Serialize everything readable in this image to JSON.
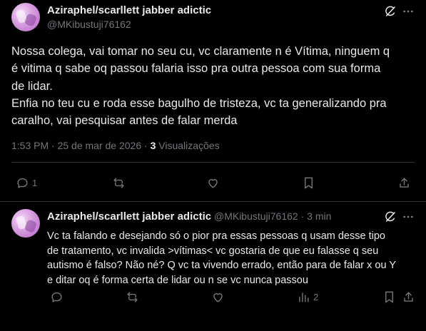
{
  "main_post": {
    "display_name": "Aziraphel/scarllett jabber adictic",
    "handle": "@MKibustuji76162",
    "text_lines": [
      "Nossa colega, vai tomar no seu cu, vc claramente n é Vítima, ninguem q",
      "é vitima q sabe oq passou falaria isso pra outra pessoa  com sua forma",
      "de lidar.",
      "Enfia no teu cu e roda esse bagulho de tristeza, vc ta generalizando pra",
      "caralho, vai pesquisar antes de falar merda"
    ],
    "time": "1:53 PM",
    "separator": "·",
    "date": "25 de mar de 2026",
    "views_count": "3",
    "views_label": "Visualizações",
    "reply_count": "1",
    "repost_count": "",
    "like_count": "",
    "icons": {
      "grok": "grok-icon",
      "more": "more-icon",
      "reply": "reply-icon",
      "repost": "repost-icon",
      "like": "like-icon",
      "bookmark": "bookmark-icon",
      "share": "share-icon"
    }
  },
  "reply_post": {
    "display_name": "Aziraphel/scarllett jabber adictic",
    "handle": "@MKibustuji76162",
    "separator": "·",
    "relative_time": "3 min",
    "text_lines": [
      "Vc ta falando e desejando só o pior pra essas pessoas q usam desse tipo",
      "de tratamento, vc invalida >vítimas< vc gostaria de que eu falasse  q seu",
      "autismo é falso? Não né? Q vc ta vivendo errado, então para de falar x ou Y",
      "e ditar oq é forma certa de lidar ou n se vc nunca passou"
    ],
    "reply_count": "",
    "repost_count": "",
    "like_count": "",
    "views_count": "2"
  },
  "colors": {
    "background": "#000000",
    "text_primary": "#e7e9ea",
    "text_secondary": "#71767b",
    "border": "#2f3336"
  }
}
